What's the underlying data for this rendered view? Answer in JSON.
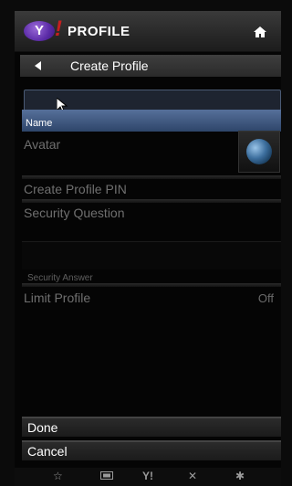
{
  "header": {
    "logo": "Y",
    "logo_mark": "!",
    "title": "PROFILE",
    "home_icon": "home-icon"
  },
  "subheader": {
    "back_icon": "back-arrow-icon",
    "label": "Create Profile"
  },
  "form": {
    "name": {
      "value": "",
      "label": "Name"
    },
    "avatar": {
      "label": "Avatar",
      "image": "globe-avatar"
    },
    "pin": {
      "label": "Create Profile PIN"
    },
    "security_question": {
      "label": "Security Question"
    },
    "security_answer": {
      "label": "Security Answer"
    },
    "limit_profile": {
      "label": "Limit Profile",
      "value": "Off"
    }
  },
  "buttons": {
    "done": "Done",
    "cancel": "Cancel"
  },
  "bottom_bar": {
    "icons": [
      "star-icon",
      "screen-icon",
      "yahoo-icon",
      "close-icon",
      "settings-icon"
    ],
    "yahoo_text": "Y!",
    "close_text": "✕",
    "star_text": "☆",
    "settings_text": "✱"
  }
}
